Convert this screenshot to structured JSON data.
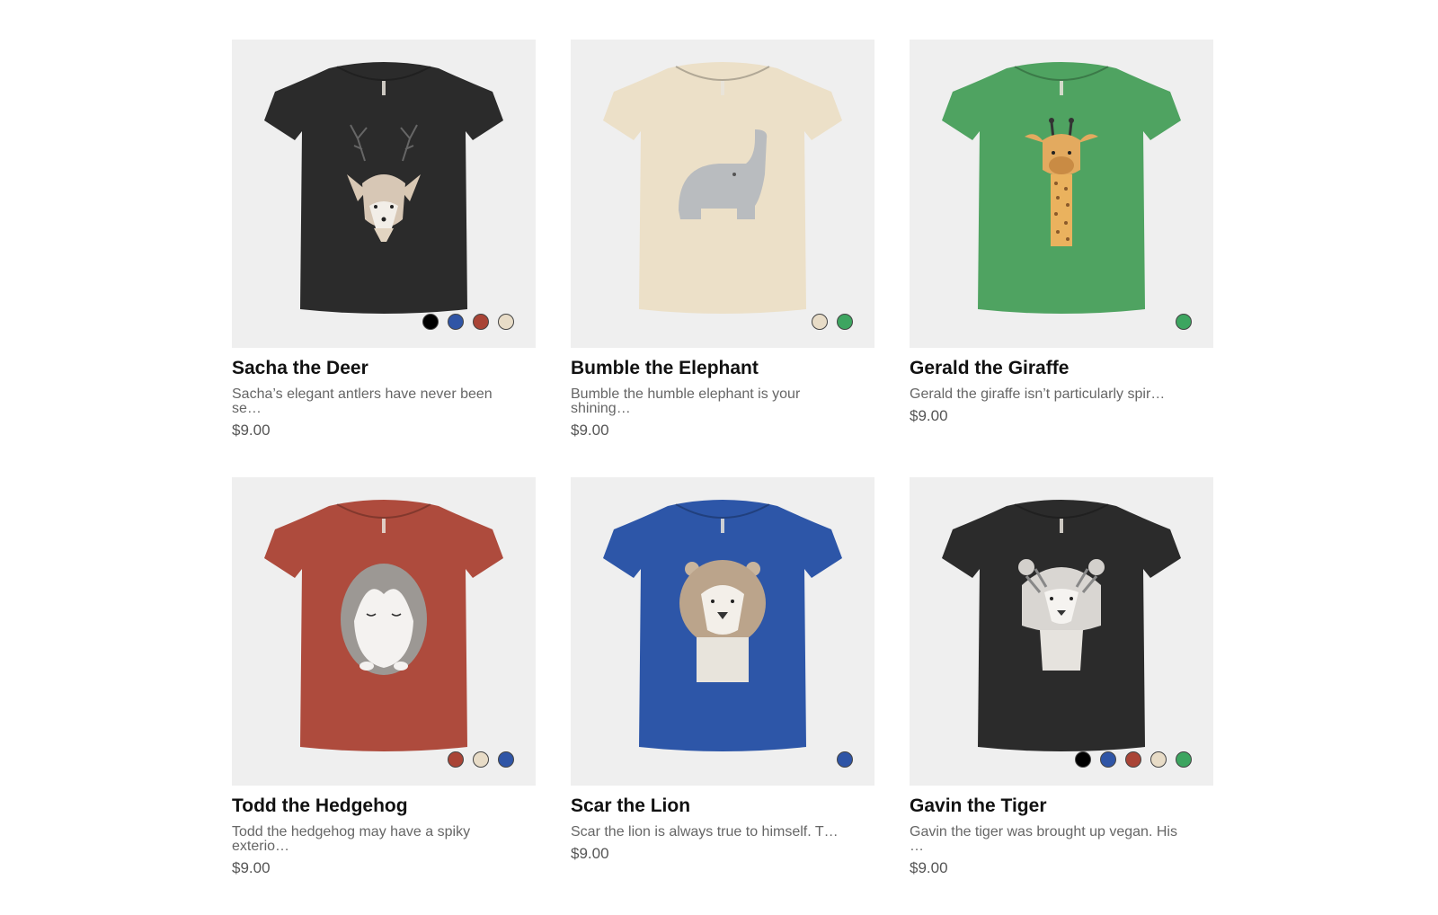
{
  "products": [
    {
      "title": "Sacha the Deer",
      "description": "Sacha’s elegant antlers have never been se…",
      "price": "$9.00",
      "shirt_color": "#2b2b2b",
      "graphic": "deer",
      "swatches": [
        "#000000",
        "#2f55a6",
        "#a94436",
        "#e8dcc7"
      ]
    },
    {
      "title": "Bumble the Elephant",
      "description": "Bumble the humble elephant is your shining…",
      "price": "$9.00",
      "shirt_color": "#ece0c8",
      "graphic": "elephant",
      "swatches": [
        "#e8dcc7",
        "#3da560"
      ]
    },
    {
      "title": "Gerald the Giraffe",
      "description": "Gerald the giraffe isn’t particularly spir…",
      "price": "$9.00",
      "shirt_color": "#4fa361",
      "graphic": "giraffe",
      "swatches": [
        "#3da560"
      ]
    },
    {
      "title": "Todd the Hedgehog",
      "description": "Todd the hedgehog may have a spiky exterio…",
      "price": "$9.00",
      "shirt_color": "#ae4b3d",
      "graphic": "hedgehog",
      "swatches": [
        "#a94436",
        "#e8dcc7",
        "#2f55a6"
      ]
    },
    {
      "title": "Scar the Lion",
      "description": "Scar the lion is always true to himself. T…",
      "price": "$9.00",
      "shirt_color": "#2d56a8",
      "graphic": "lion",
      "swatches": [
        "#2f55a6"
      ]
    },
    {
      "title": "Gavin the Tiger",
      "description": "Gavin the tiger was brought up vegan. His …",
      "price": "$9.00",
      "shirt_color": "#2b2b2b",
      "graphic": "tiger",
      "swatches": [
        "#000000",
        "#2f55a6",
        "#a94436",
        "#e8dcc7",
        "#3da560"
      ]
    }
  ]
}
